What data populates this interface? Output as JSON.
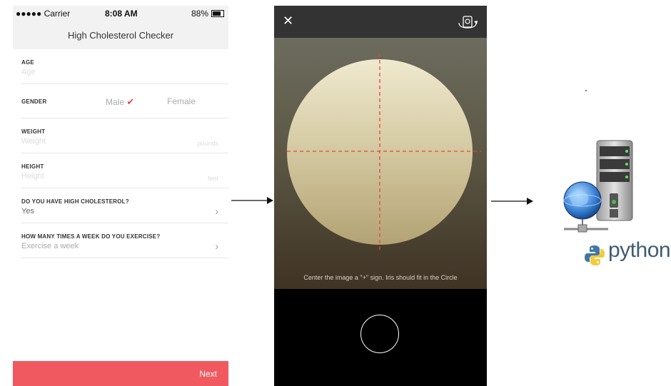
{
  "status_bar": {
    "carrier": "●●●●● Carrier",
    "time": "8:08 AM",
    "battery": "88%"
  },
  "form": {
    "title": "High Cholesterol Checker",
    "age": {
      "label": "AGE",
      "placeholder": "Age"
    },
    "gender": {
      "label": "GENDER",
      "options": [
        "Male",
        "Female"
      ],
      "selected": "Male"
    },
    "weight": {
      "label": "WEIGHT",
      "placeholder": "Weight",
      "unit": "pounds"
    },
    "height": {
      "label": "HEIGHT",
      "placeholder": "Height",
      "unit": "feet"
    },
    "cholesterol": {
      "label": "DO YOU HAVE HIGH CHOLESTEROL?",
      "value": "Yes"
    },
    "exercise": {
      "label": "HOW MANY TIMES A WEEK DO YOU EXERCISE?",
      "placeholder": "Exercise a week"
    },
    "next_label": "Next"
  },
  "camera": {
    "hint": "Center the image a \"+\" sign.  Iris should fit in the Circle",
    "close_icon": "close-icon",
    "flip_icon": "camera-flip-icon"
  },
  "backend": {
    "server_icon": "server-globe-icon",
    "python_logo_text": "python"
  },
  "colors": {
    "accent": "#f0595f",
    "check": "#e04848",
    "crosshair": "#e8453c"
  }
}
